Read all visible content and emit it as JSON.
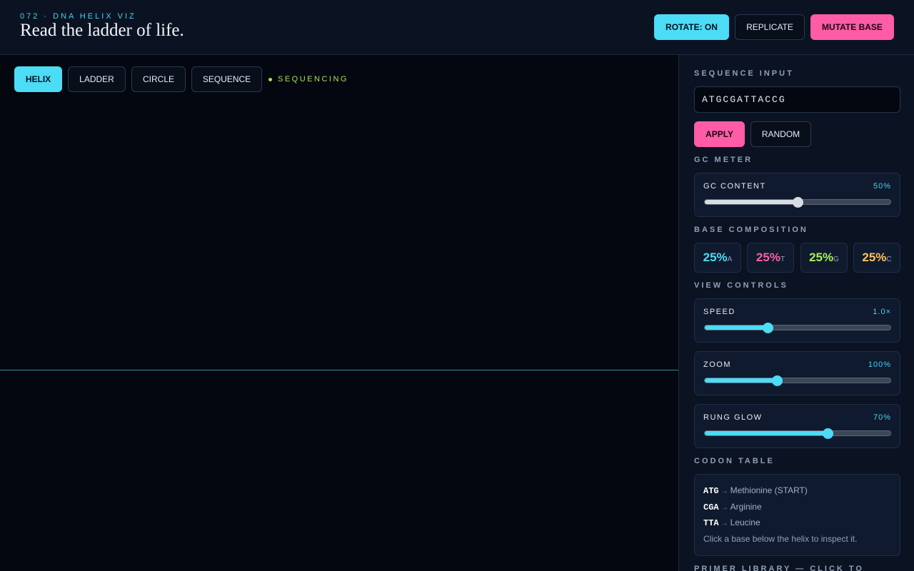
{
  "header": {
    "kicker": "072 · DNA HELIX VIZ",
    "title": "Read the ladder of life.",
    "rotate_label": "ROTATE: ON",
    "replicate_label": "REPLICATE",
    "mutate_label": "MUTATE BASE"
  },
  "view_tabs": [
    "HELIX",
    "LADDER",
    "CIRCLE",
    "SEQUENCE"
  ],
  "active_tab": "HELIX",
  "status": "SEQUENCING",
  "sidebar": {
    "sequence_title": "SEQUENCE INPUT",
    "sequence_value": "ATGCGATTACCG",
    "apply_label": "APPLY",
    "random_label": "RANDOM",
    "gc_title": "GC METER",
    "gc_label": "GC CONTENT",
    "gc_value": "50%",
    "gc_fraction": 0.5,
    "composition_title": "BASE COMPOSITION",
    "composition": [
      {
        "value": "25%",
        "base": "A",
        "color": "#4cdcf6"
      },
      {
        "value": "25%",
        "base": "T",
        "color": "#ff5ca7"
      },
      {
        "value": "25%",
        "base": "G",
        "color": "#a6f05a"
      },
      {
        "value": "25%",
        "base": "C",
        "color": "#ffc35a"
      }
    ],
    "view_controls_title": "VIEW CONTROLS",
    "speed": {
      "label": "SPEED",
      "value": "1.0×",
      "fraction": 0.34
    },
    "zoom": {
      "label": "ZOOM",
      "value": "100%",
      "fraction": 0.39
    },
    "rung_glow": {
      "label": "RUNG GLOW",
      "value": "70%",
      "fraction": 0.66
    },
    "codon_title": "CODON TABLE",
    "codons": [
      {
        "codon": "ATG",
        "name": "Methionine (START)"
      },
      {
        "codon": "CGA",
        "name": "Arginine"
      },
      {
        "codon": "TTA",
        "name": "Leucine"
      }
    ],
    "codon_hint": "Click a base below the helix to inspect it.",
    "primer_title": "PRIMER LIBRARY — CLICK TO"
  },
  "colors": {
    "accent": "#4cdcf6",
    "pink": "#ff5ca7",
    "green": "#a6e05a",
    "panel": "#0b1322",
    "background": "#04070f"
  }
}
